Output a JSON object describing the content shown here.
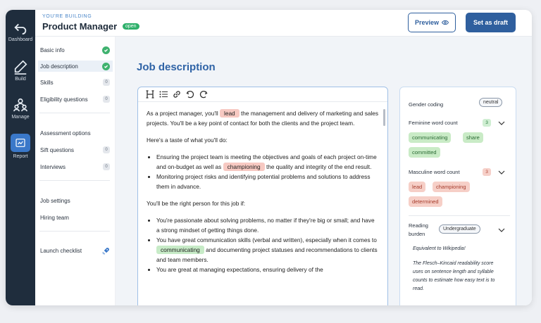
{
  "nav": {
    "items": [
      {
        "label": "Dashboard",
        "icon": "back-arrow-icon"
      },
      {
        "label": "Build",
        "icon": "pen-icon"
      },
      {
        "label": "Manage",
        "icon": "people-icon"
      },
      {
        "label": "Report",
        "icon": "report-icon"
      }
    ]
  },
  "header": {
    "eyebrow": "YOU'RE BUILDING",
    "title": "Product Manager",
    "status_badge": "open",
    "preview_label": "Preview",
    "draft_label": "Set as draft"
  },
  "steps": {
    "basic_info": "Basic info",
    "job_description": "Job description",
    "skills": {
      "label": "Skills",
      "count": "0"
    },
    "eligibility": {
      "label": "Eligibility questions",
      "count": "0"
    },
    "assessment": "Assessment options",
    "sift": {
      "label": "Sift questions",
      "count": "0"
    },
    "interviews": {
      "label": "Interviews",
      "count": "0"
    },
    "job_settings": "Job settings",
    "hiring_team": "Hiring team",
    "launch": "Launch checklist"
  },
  "main": {
    "section_title": "Job description"
  },
  "editor": {
    "p1_a": "As a project manager, you'll",
    "p1_hl": "lead",
    "p1_b": "the management and delivery of marketing and sales projects. You'll be a key point of contact for both the clients and the project team.",
    "p2": "Here's a taste of what you'll do:",
    "li1_a": "Ensuring the project team is meeting the objectives and goals of each project on-time and on-budget as well as",
    "li1_hl": "championing",
    "li1_b": "the quality and integrity of the end result.",
    "li2": "Monitoring project risks and identifying potential problems and solutions to address them in advance.",
    "p3": "You'll be the right person for this job if:",
    "li3": "You're passionate about solving problems, no matter if they're big or small; and have a strong mindset of getting things done.",
    "li4_a": "You have great communication skills (verbal and written), especially when it comes to",
    "li4_hl": "communicating",
    "li4_b": "and documenting project statuses and recommendations to clients and team members.",
    "li5": "You are great at managing expectations, ensuring delivery of the"
  },
  "panel": {
    "gender_label": "Gender coding",
    "gender_value": "neutral",
    "feminine_label": "Feminine word count",
    "feminine_count": "3",
    "feminine_words": [
      "communicating",
      "share",
      "committed"
    ],
    "masculine_label": "Masculine word count",
    "masculine_count": "3",
    "masculine_words": [
      "lead",
      "championing",
      "determined"
    ],
    "reading_label_1": "Reading",
    "reading_label_2": "burden",
    "reading_value": "Undergraduate",
    "equivalent": "Equivalent to Wikipedia!",
    "flesch": "The Flesch–Kincaid readability score uses on sentence length and syllable counts to estimate how easy text is to read."
  },
  "colors": {
    "rail": "#1f2d3d",
    "accent": "#2f5f9e",
    "success": "#3fb26f",
    "highlight_red": "#f7c9c2",
    "highlight_green": "#c7ebc7"
  }
}
